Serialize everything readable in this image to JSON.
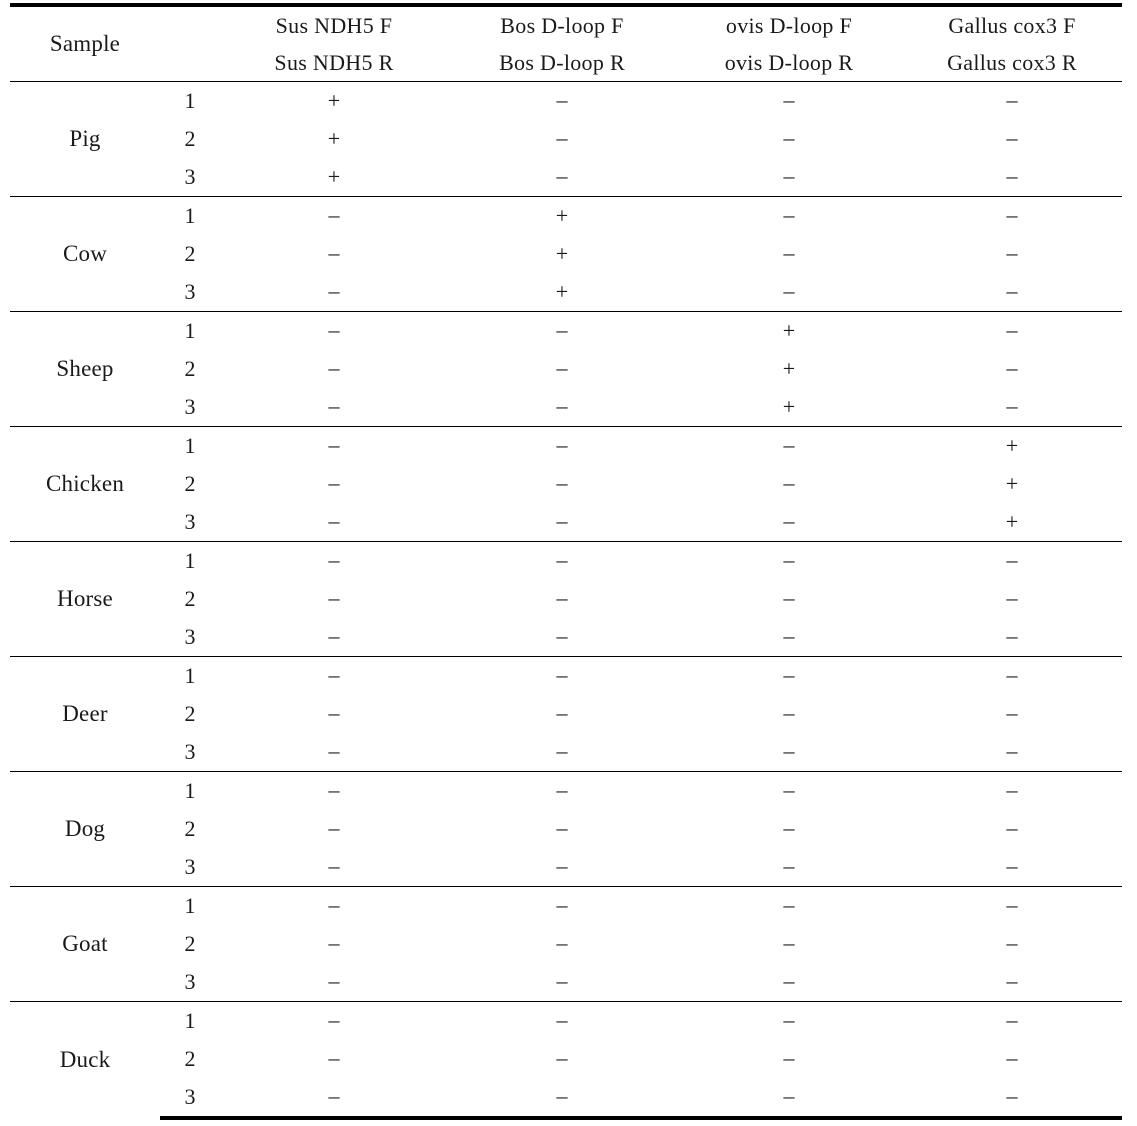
{
  "table": {
    "sample_header": "Sample",
    "replicate_header": "",
    "primer_columns": [
      {
        "forward": "Sus  NDH5  F",
        "reverse": "Sus  NDH5  R"
      },
      {
        "forward": "Bos  D-loop  F",
        "reverse": "Bos  D-loop  R"
      },
      {
        "forward": "ovis  D-loop  F",
        "reverse": "ovis  D-loop  R"
      },
      {
        "forward": "Gallus  cox3  F",
        "reverse": "Gallus  cox3  R"
      }
    ],
    "positive_mark": "+",
    "negative_mark": "–",
    "groups": [
      {
        "sample": "Pig",
        "rows": [
          {
            "replicate": "1",
            "results": [
              "+",
              "–",
              "–",
              "–"
            ]
          },
          {
            "replicate": "2",
            "results": [
              "+",
              "–",
              "–",
              "–"
            ]
          },
          {
            "replicate": "3",
            "results": [
              "+",
              "–",
              "–",
              "–"
            ]
          }
        ]
      },
      {
        "sample": "Cow",
        "rows": [
          {
            "replicate": "1",
            "results": [
              "–",
              "+",
              "–",
              "–"
            ]
          },
          {
            "replicate": "2",
            "results": [
              "–",
              "+",
              "–",
              "–"
            ]
          },
          {
            "replicate": "3",
            "results": [
              "–",
              "+",
              "–",
              "–"
            ]
          }
        ]
      },
      {
        "sample": "Sheep",
        "rows": [
          {
            "replicate": "1",
            "results": [
              "–",
              "–",
              "+",
              "–"
            ]
          },
          {
            "replicate": "2",
            "results": [
              "–",
              "–",
              "+",
              "–"
            ]
          },
          {
            "replicate": "3",
            "results": [
              "–",
              "–",
              "+",
              "–"
            ]
          }
        ]
      },
      {
        "sample": "Chicken",
        "rows": [
          {
            "replicate": "1",
            "results": [
              "–",
              "–",
              "–",
              "+"
            ]
          },
          {
            "replicate": "2",
            "results": [
              "–",
              "–",
              "–",
              "+"
            ]
          },
          {
            "replicate": "3",
            "results": [
              "–",
              "–",
              "–",
              "+"
            ]
          }
        ]
      },
      {
        "sample": "Horse",
        "rows": [
          {
            "replicate": "1",
            "results": [
              "–",
              "–",
              "–",
              "–"
            ]
          },
          {
            "replicate": "2",
            "results": [
              "–",
              "–",
              "–",
              "–"
            ]
          },
          {
            "replicate": "3",
            "results": [
              "–",
              "–",
              "–",
              "–"
            ]
          }
        ]
      },
      {
        "sample": "Deer",
        "rows": [
          {
            "replicate": "1",
            "results": [
              "–",
              "–",
              "–",
              "–"
            ]
          },
          {
            "replicate": "2",
            "results": [
              "–",
              "–",
              "–",
              "–"
            ]
          },
          {
            "replicate": "3",
            "results": [
              "–",
              "–",
              "–",
              "–"
            ]
          }
        ]
      },
      {
        "sample": "Dog",
        "rows": [
          {
            "replicate": "1",
            "results": [
              "–",
              "–",
              "–",
              "–"
            ]
          },
          {
            "replicate": "2",
            "results": [
              "–",
              "–",
              "–",
              "–"
            ]
          },
          {
            "replicate": "3",
            "results": [
              "–",
              "–",
              "–",
              "–"
            ]
          }
        ]
      },
      {
        "sample": "Goat",
        "rows": [
          {
            "replicate": "1",
            "results": [
              "–",
              "–",
              "–",
              "–"
            ]
          },
          {
            "replicate": "2",
            "results": [
              "–",
              "–",
              "–",
              "–"
            ]
          },
          {
            "replicate": "3",
            "results": [
              "–",
              "–",
              "–",
              "–"
            ]
          }
        ]
      },
      {
        "sample": "Duck",
        "rows": [
          {
            "replicate": "1",
            "results": [
              "–",
              "–",
              "–",
              "–"
            ]
          },
          {
            "replicate": "2",
            "results": [
              "–",
              "–",
              "–",
              "–"
            ]
          },
          {
            "replicate": "3",
            "results": [
              "–",
              "–",
              "–",
              "–"
            ]
          }
        ]
      }
    ]
  }
}
